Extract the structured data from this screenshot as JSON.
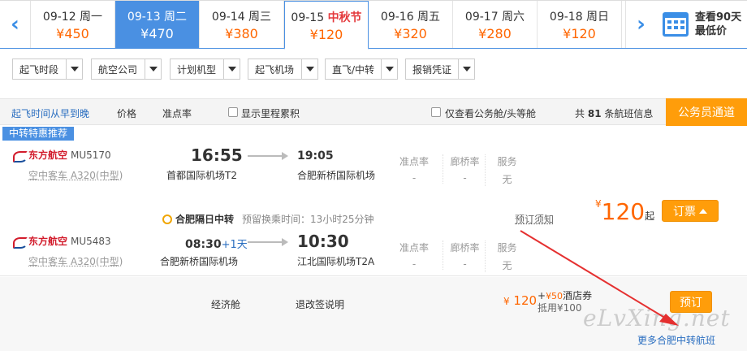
{
  "datebar": {
    "dates": [
      {
        "date": "09-12 周一",
        "price": "¥450",
        "state": "normal",
        "festival": ""
      },
      {
        "date": "09-13 周二",
        "price": "¥470",
        "state": "selected",
        "festival": ""
      },
      {
        "date": "09-14 周三",
        "price": "¥380",
        "state": "normal",
        "festival": ""
      },
      {
        "date": "09-15",
        "price": "¥120",
        "state": "today",
        "festival": "中秋节"
      },
      {
        "date": "09-16 周五",
        "price": "¥320",
        "state": "normal",
        "festival": ""
      },
      {
        "date": "09-17 周六",
        "price": "¥280",
        "state": "normal",
        "festival": ""
      },
      {
        "date": "09-18 周日",
        "price": "¥120",
        "state": "normal",
        "festival": ""
      }
    ],
    "calendar_line1": "查看90天",
    "calendar_line2": "最低价",
    "prev_icon": "chevron-left-icon",
    "next_icon": "chevron-right-icon"
  },
  "filters": [
    "起飞时段",
    "航空公司",
    "计划机型",
    "起飞机场",
    "直飞/中转",
    "报销凭证"
  ],
  "sortbar": {
    "sort_time": "起飞时间从早到晚",
    "sort_price": "价格",
    "sort_ontime": "准点率",
    "show_miles": "显示里程累积",
    "business_only": "仅查看公务舱/头等舱",
    "count_prefix": "共",
    "count": "81",
    "count_suffix": "条航班信息",
    "civil_button": "公务员通道"
  },
  "badge": "中转特惠推荐",
  "flight1": {
    "airline": "东方航空",
    "flight_no": "MU5170",
    "plane": "空中客车 A320(中型)",
    "dep_time": "16:55",
    "dep_airport": "首都国际机场T2",
    "arr_time": "19:05",
    "arr_airport": "合肥新桥国际机场",
    "ontime_label": "准点率",
    "ontime_value": "-",
    "bridge_label": "廊桥率",
    "bridge_value": "-",
    "service_label": "服务",
    "service_value": "无"
  },
  "transfer": {
    "label": "合肥隔日中转",
    "wait": "预留换乘时间：13小时25分钟",
    "notice": "预订须知"
  },
  "price": {
    "symbol": "¥",
    "value": "120",
    "suffix": "起"
  },
  "book_button": "订票",
  "flight2": {
    "airline": "东方航空",
    "flight_no": "MU5483",
    "plane": "空中客车 A320(中型)",
    "dep_time": "08:30",
    "plus_day": "+1天",
    "dep_airport": "合肥新桥国际机场",
    "arr_time": "10:30",
    "arr_airport": "江北国际机场T2A",
    "ontime_label": "准点率",
    "ontime_value": "-",
    "bridge_label": "廊桥率",
    "bridge_value": "-",
    "service_label": "服务",
    "service_value": "无"
  },
  "cabin": {
    "class": "经济舱",
    "refund": "退改签说明",
    "price_symbol": "¥",
    "price": "120",
    "plus": "+",
    "hotel_amount": "¥50",
    "hotel_label": "酒店券",
    "hotel_sub": "抵用¥100",
    "book_button": "预订",
    "more_link": "更多合肥中转航班"
  },
  "watermark": "eLvXing.net",
  "colors": {
    "accent": "#4a90e2",
    "price": "#ff6600",
    "button": "#ff9d0a",
    "airline": "#d21c2c"
  }
}
